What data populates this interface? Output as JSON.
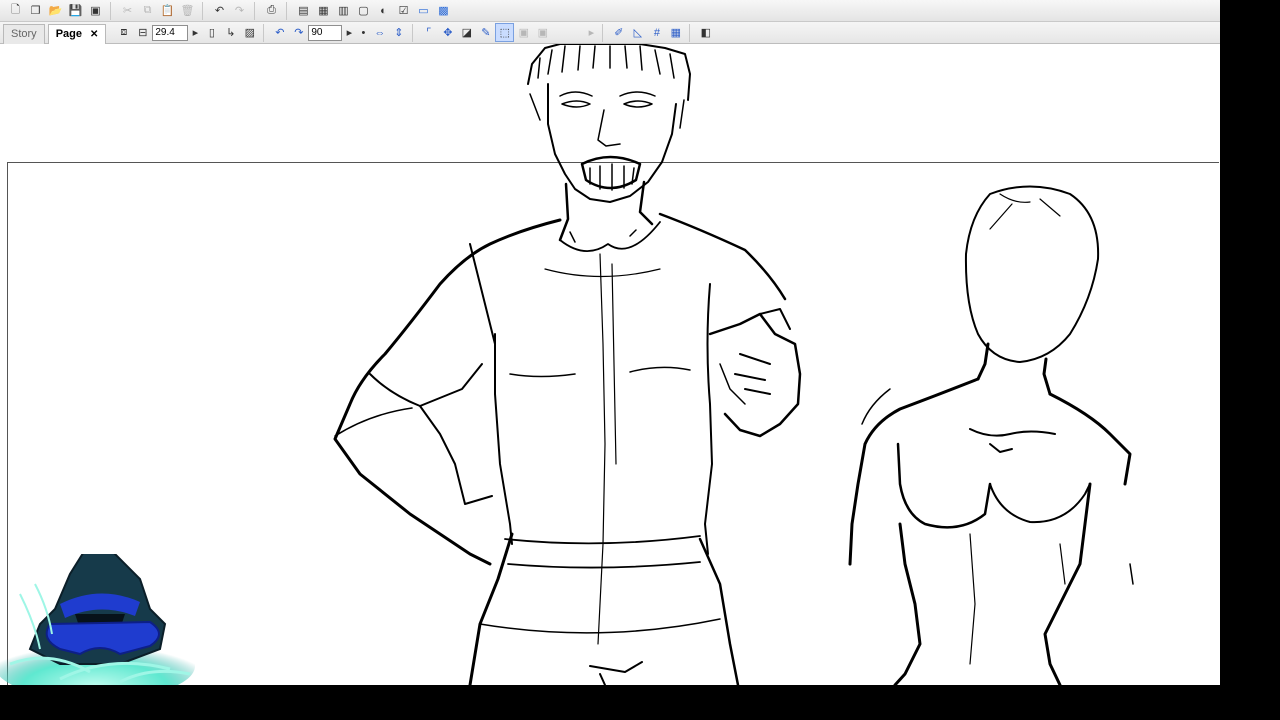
{
  "toolbar": {
    "icons": [
      "new-document-icon",
      "new-page-icon",
      "open-icon",
      "save-icon",
      "save-all-icon",
      "cut-icon",
      "copy-icon",
      "paste-icon",
      "delete-icon",
      "undo-icon",
      "redo-icon",
      "print-icon",
      "page-layout-icon",
      "page-grid-icon",
      "page-columns-icon",
      "page-frame-icon",
      "toggle-layer-icon",
      "check-icon",
      "window-icon",
      "color-palette-icon"
    ]
  },
  "tabs": {
    "story": "Story",
    "page": "Page",
    "close": "✕"
  },
  "page_toolbar": {
    "zoom_value": "29.4",
    "rotation_value": "90"
  },
  "colors": {
    "window_bg": "#ffffff",
    "screen_bg": "#000000",
    "avatar_accent": "#1f3ccf",
    "avatar_glow": "#5fe8d0"
  }
}
